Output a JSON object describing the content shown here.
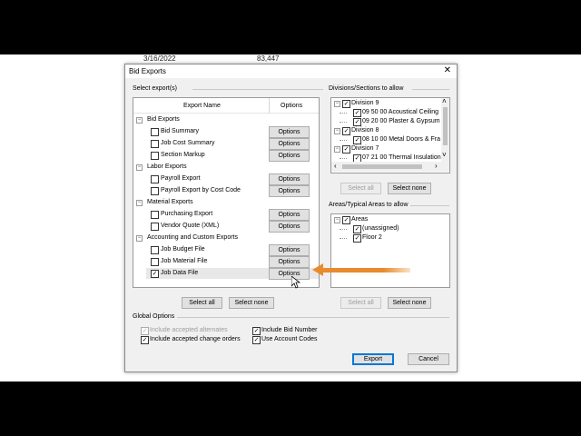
{
  "background": {
    "date_text": "3/16/2022",
    "amount_text": "83,447"
  },
  "dialog": {
    "title": "Bid Exports",
    "close_glyph": "✕",
    "select_exports_label": "Select export(s)",
    "columns": {
      "name": "Export Name",
      "options": "Options"
    },
    "groups": [
      {
        "label": "Bid Exports",
        "items": [
          {
            "label": "Bid Summary",
            "checked": false,
            "options": "Options"
          },
          {
            "label": "Job Cost Summary",
            "checked": false,
            "options": "Options"
          },
          {
            "label": "Section Markup",
            "checked": false,
            "options": "Options"
          }
        ]
      },
      {
        "label": "Labor Exports",
        "items": [
          {
            "label": "Payroll Export",
            "checked": false,
            "options": "Options"
          },
          {
            "label": "Payroll Export by Cost Code",
            "checked": false,
            "options": "Options"
          }
        ]
      },
      {
        "label": "Material Exports",
        "items": [
          {
            "label": "Purchasing Export",
            "checked": false,
            "options": "Options"
          },
          {
            "label": "Vendor Quote (XML)",
            "checked": false,
            "options": "Options"
          }
        ]
      },
      {
        "label": "Accounting and Custom Exports",
        "items": [
          {
            "label": "Job Budget File",
            "checked": false,
            "options": "Options"
          },
          {
            "label": "Job Material File",
            "checked": false,
            "options": "Options"
          },
          {
            "label": "Job Data File",
            "checked": true,
            "options": "Options"
          }
        ]
      }
    ],
    "left_buttons": {
      "select_all": "Select all",
      "select_none": "Select none"
    },
    "divisions_label": "Divisions/Sections to allow",
    "divisions": [
      {
        "label": "Division 9",
        "level": 0,
        "checked": true
      },
      {
        "label": "09 50 00 Acoustical Ceiling",
        "level": 1,
        "checked": true
      },
      {
        "label": "09 20 00 Plaster & Gypsum",
        "level": 1,
        "checked": true
      },
      {
        "label": "Division 8",
        "level": 0,
        "checked": true
      },
      {
        "label": "08 10 00 Metal Doors & Fra",
        "level": 1,
        "checked": true
      },
      {
        "label": "Division 7",
        "level": 0,
        "checked": true
      },
      {
        "label": "07 21 00 Thermal Insulation",
        "level": 1,
        "checked": true
      }
    ],
    "div_buttons": {
      "select_all": "Select all",
      "select_none": "Select none"
    },
    "areas_label": "Areas/Typical Areas to allow",
    "areas": [
      {
        "label": "Areas",
        "level": 0,
        "checked": true
      },
      {
        "label": "(unassigned)",
        "level": 1,
        "checked": true
      },
      {
        "label": "Floor 2",
        "level": 1,
        "checked": true
      }
    ],
    "area_buttons": {
      "select_all": "Select all",
      "select_none": "Select none"
    },
    "global_options_label": "Global Options",
    "global_options": {
      "include_accepted_alternates": {
        "label": "Include accepted alternates",
        "checked": true,
        "disabled": true
      },
      "include_accepted_change_orders": {
        "label": "Include accepted change orders",
        "checked": true,
        "disabled": false
      },
      "include_bid_number": {
        "label": "Include Bid Number",
        "checked": true,
        "disabled": false
      },
      "use_account_codes": {
        "label": "Use Account Codes",
        "checked": true,
        "disabled": false
      }
    },
    "footer": {
      "export": "Export",
      "cancel": "Cancel"
    },
    "accent_color": "#e88b2c",
    "scroll_up_glyph": "˄",
    "scroll_down_glyph": "˅",
    "scroll_left_glyph": "‹",
    "scroll_right_glyph": "›"
  }
}
